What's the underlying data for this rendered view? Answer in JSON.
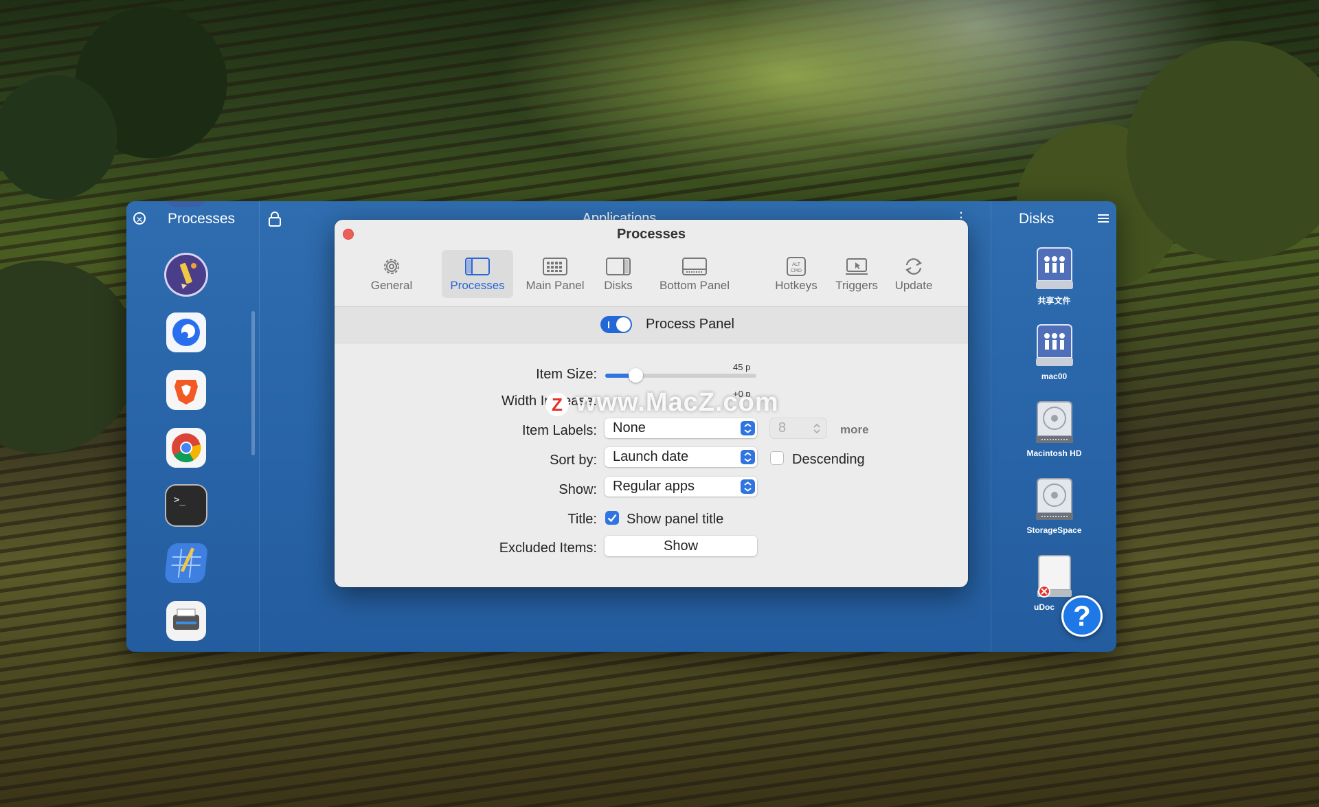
{
  "colors": {
    "accent": "#2f74e0",
    "panel_blue": "#2c68ab",
    "close_red": "#ec5f57"
  },
  "left_panel": {
    "title": "Processes",
    "close_icon": "close-circle-icon",
    "apps": [
      "pencil-app-icon",
      "browser-app-icon",
      "brave-browser-icon",
      "chrome-browser-icon",
      "terminal-app-icon",
      "blueprint-app-icon",
      "scanner-app-icon"
    ]
  },
  "center_panel": {
    "title": "Applications",
    "lock_icon": "lock-icon",
    "more_icon": "vertical-ellipsis-icon"
  },
  "right_panel": {
    "title": "Disks",
    "menu_icon": "hamburger-menu-icon",
    "disks": [
      {
        "label": "共享文件",
        "icon": "shared-folder-disk-icon"
      },
      {
        "label": "mac00",
        "icon": "shared-folder-disk-icon"
      },
      {
        "label": "Macintosh HD",
        "icon": "hard-disk-icon"
      },
      {
        "label": "StorageSpace",
        "icon": "hard-disk-icon"
      },
      {
        "label": "uDoc",
        "icon": "removable-disk-icon"
      }
    ],
    "help": "?"
  },
  "dialog": {
    "title": "Processes",
    "toolbar": [
      {
        "label": "General",
        "icon": "gear-icon"
      },
      {
        "label": "Processes",
        "icon": "sidebar-panel-icon",
        "active": true
      },
      {
        "label": "Main Panel",
        "icon": "grid-panel-icon"
      },
      {
        "label": "Disks",
        "icon": "right-panel-icon"
      },
      {
        "label": "Bottom Panel",
        "icon": "bottom-panel-icon"
      },
      {
        "label": "Hotkeys",
        "icon": "alt-cmd-key-icon"
      },
      {
        "label": "Triggers",
        "icon": "trigger-screen-icon"
      },
      {
        "label": "Update",
        "icon": "refresh-icon"
      }
    ],
    "section": {
      "label": "Process Panel",
      "enabled": true
    },
    "item_size": {
      "label": "Item Size:",
      "value_text": "45 p",
      "level": 0.2
    },
    "width_increase": {
      "label": "Width Increase:",
      "value_text": "+0 p"
    },
    "item_labels": {
      "label": "Item Labels:",
      "value": "None",
      "stepper_value": "8",
      "more": "more"
    },
    "sort_by": {
      "label": "Sort by:",
      "value": "Launch date",
      "descending_label": "Descending",
      "descending": false
    },
    "show": {
      "label": "Show:",
      "value": "Regular apps"
    },
    "title_row": {
      "label": "Title:",
      "checkbox_label": "Show panel title",
      "checked": true
    },
    "excluded": {
      "label": "Excluded Items:",
      "button": "Show"
    }
  },
  "watermark": {
    "logo": "Z",
    "text": "www.MacZ.com"
  }
}
